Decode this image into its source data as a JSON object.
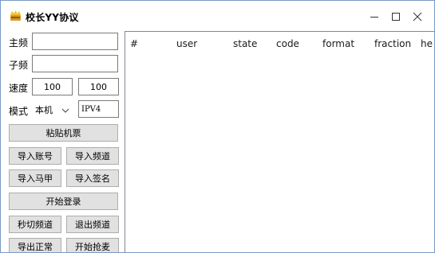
{
  "window": {
    "title": "校长YY协议",
    "icon": "app-crown-icon",
    "controls": {
      "minimize": "minimize-icon",
      "maximize": "maximize-icon",
      "close": "close-icon"
    }
  },
  "form": {
    "main_freq_label": "主频",
    "main_freq_value": "",
    "sub_freq_label": "子频",
    "sub_freq_value": "",
    "speed_label": "速度",
    "speed_value_1": "100",
    "speed_value_2": "100",
    "mode_label": "模式",
    "mode_selected": "本机",
    "ip_value": "IPV4"
  },
  "buttons": {
    "paste_ticket": "粘贴机票",
    "import_account": "导入账号",
    "import_channel": "导入频道",
    "import_vest": "导入马甲",
    "import_signature": "导入签名",
    "start_login": "开始登录",
    "quick_switch_channel": "秒切频道",
    "exit_channel": "退出频道",
    "export_normal": "导出正常",
    "start_grab_mic": "开始抢麦"
  },
  "table": {
    "columns": [
      "#",
      "user",
      "state",
      "code",
      "format",
      "fraction",
      "he"
    ],
    "rows": []
  },
  "colors": {
    "window_border": "#7a99c6",
    "button_bg": "#e1e1e1",
    "button_border": "#adadad",
    "input_border": "#7a7a7a"
  }
}
